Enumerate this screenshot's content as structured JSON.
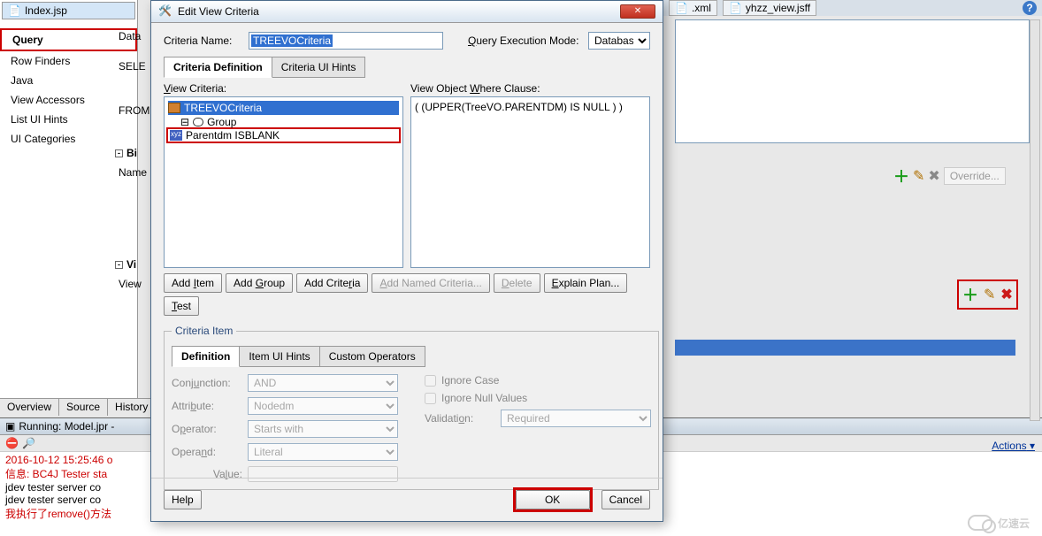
{
  "top_tabs": {
    "left": "Index.jsp",
    "right1": ".xml",
    "right2": "yhzz_view.jsff"
  },
  "nav": {
    "items": [
      "Query",
      "Row Finders",
      "Java",
      "View Accessors",
      "List UI Hints",
      "UI Categories"
    ],
    "highlighted_index": 0
  },
  "mid": {
    "data": "Data",
    "sele": "SELE",
    "from": "FROM",
    "bi": "Bi",
    "name": "Name",
    "vi": "Vi",
    "view": "View"
  },
  "editor_tabs": [
    "Overview",
    "Source",
    "History"
  ],
  "run": {
    "title": "Running: Model.jpr -",
    "actions": "Actions",
    "lines": [
      {
        "cls": "ts",
        "text": "2016-10-12 15:25:46 o"
      },
      {
        "cls": "info",
        "text": "信息: BC4J Tester sta"
      },
      {
        "cls": "",
        "text": "jdev tester server co"
      },
      {
        "cls": "",
        "text": "jdev tester server co"
      },
      {
        "cls": "info",
        "text": "我执行了remove()方法"
      }
    ]
  },
  "dialog": {
    "title": "Edit View Criteria",
    "criteria_name_label": "Criteria Name:",
    "criteria_name_value": "TREEVOCriteria",
    "exec_mode_label": "Query Execution Mode:",
    "exec_mode_value": "Database",
    "tabs": [
      "Criteria Definition",
      "Criteria UI Hints"
    ],
    "view_criteria_label": "View Criteria:",
    "where_label": "View Object Where Clause:",
    "where_text": "( (UPPER(TreeVO.PARENTDM) IS NULL ) )",
    "tree": {
      "root": "TREEVOCriteria",
      "group": "Group",
      "item": "Parentdm ISBLANK"
    },
    "buttons": {
      "add_item": "Add Item",
      "add_group": "Add Group",
      "add_criteria": "Add Criteria",
      "add_named": "Add Named Criteria...",
      "delete": "Delete",
      "explain": "Explain Plan...",
      "test": "Test"
    },
    "ci": {
      "legend": "Criteria Item",
      "tabs": [
        "Definition",
        "Item UI Hints",
        "Custom Operators"
      ],
      "conjunction_label": "Conjunction:",
      "conjunction": "AND",
      "attribute_label": "Attribute:",
      "attribute": "Nodedm",
      "operator_label": "Operator:",
      "operator": "Starts with",
      "operand_label": "Operand:",
      "operand": "Literal",
      "value_label": "Value:",
      "value": "",
      "ignore_case": "Ignore Case",
      "ignore_null": "Ignore Null Values",
      "validation_label": "Validation:",
      "validation": "Required"
    },
    "footer": {
      "help": "Help",
      "ok": "OK",
      "cancel": "Cancel"
    }
  },
  "right": {
    "override": "Override...",
    "watermark": "亿速云"
  }
}
